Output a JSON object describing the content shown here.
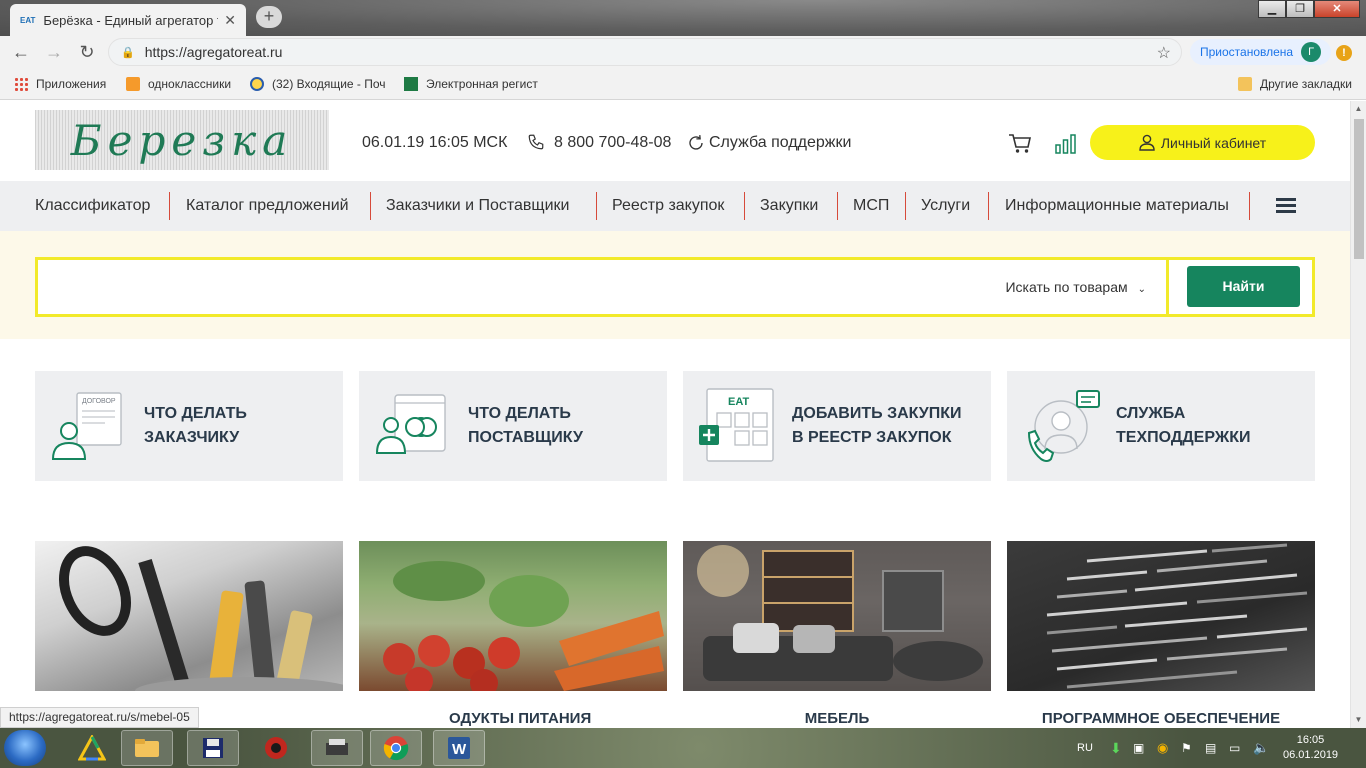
{
  "browser": {
    "tab_title": "Берёзка - Единый агрегатор тор",
    "tab_favicon_text": "EAT",
    "url": "https://agregatoreat.ru",
    "profile_status": "Приостановлена",
    "profile_initial": "Г",
    "bookmarks": [
      "Приложения",
      "одноклассники",
      "(32) Входящие - Поч",
      "Электронная регист"
    ],
    "other_bookmarks": "Другие закладки",
    "status_url": "https://agregatoreat.ru/s/mebel-05"
  },
  "header": {
    "logo_text": "Березка",
    "datetime": "06.01.19 16:05 МСК",
    "phone": "8 800 700-48-08",
    "support": "Служба поддержки",
    "cabinet": "Личный кабинет"
  },
  "menu": [
    "Классификатор",
    "Каталог предложений",
    "Заказчики и Поставщики",
    "Реестр закупок",
    "Закупки",
    "МСП",
    "Услуги",
    "Информационные материалы"
  ],
  "search": {
    "value": "",
    "scope": "Искать по товарам",
    "button": "Найти"
  },
  "cards": [
    {
      "line1": "ЧТО ДЕЛАТЬ",
      "line2": "ЗАКАЗЧИКУ",
      "icon_text": "ДОГОВОР"
    },
    {
      "line1": "ЧТО ДЕЛАТЬ",
      "line2": "ПОСТАВЩИКУ"
    },
    {
      "line1": "ДОБАВИТЬ ЗАКУПКИ",
      "line2": "В РЕЕСТР ЗАКУПОК",
      "icon_text": "EAT"
    },
    {
      "line1": "СЛУЖБА",
      "line2": "ТЕХПОДДЕРЖКИ"
    }
  ],
  "categories": [
    "ОДУКТЫ ПИТАНИЯ",
    "МЕБЕЛЬ",
    "ПРОГРАММНОЕ ОБЕСПЕЧЕНИЕ"
  ],
  "taskbar": {
    "lang": "RU",
    "time": "16:05",
    "date": "06.01.2019"
  },
  "colors": {
    "brand_green": "#16855e",
    "yellow": "#f7f11a",
    "menu_separator": "#d64a3b"
  }
}
